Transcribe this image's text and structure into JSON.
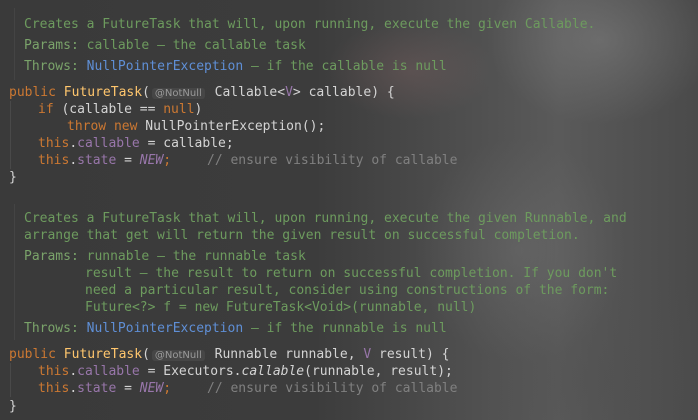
{
  "doc1": {
    "summary": "Creates a FutureTask that will, upon running, execute the given Callable.",
    "params_label": "Params:",
    "params_text": "callable – the callable task",
    "throws_label": "Throws:",
    "throws_link": "NullPointerException",
    "throws_text": " – if the callable is null"
  },
  "code1": {
    "sig_public": "public ",
    "sig_name": "FutureTask",
    "sig_paren": "(",
    "annotation": "@NotNull",
    "sig_type": " Callable<",
    "sig_typeparam": "V",
    "sig_rest": "> callable) {",
    "if_kw": "if ",
    "if_cond": "(callable == ",
    "null_kw": "null",
    "if_close": ")",
    "throw_kw": "throw new ",
    "throw_rest": "NullPointerException();",
    "this_kw": "this",
    "dot": ".",
    "field_callable": "callable",
    "assign_callable": " = callable;",
    "field_state": "state",
    "assign_eq": " = ",
    "const_new": "NEW",
    "semi": ";",
    "comment": "// ensure visibility of callable",
    "close_brace": "}"
  },
  "doc2": {
    "summary_line1": "Creates a FutureTask that will, upon running, execute the given Runnable, and",
    "summary_line2": "arrange that get will return the given result on successful completion.",
    "params_label": "Params:",
    "param1": "runnable – the runnable task",
    "param2_line1": "result – the result to return on successful completion. If you don't",
    "param2_line2": "need a particular result, consider using constructions of the form:",
    "param2_line3": "Future<?> f = new FutureTask<Void>(runnable, null)",
    "throws_label": "Throws:",
    "throws_link": "NullPointerException",
    "throws_text": " – if the runnable is null"
  },
  "code2": {
    "sig_public": "public ",
    "sig_name": "FutureTask",
    "sig_paren": "(",
    "annotation": "@NotNull",
    "sig_type": " Runnable runnable, ",
    "sig_typeparam": "V",
    "sig_rest": " result) {",
    "this_kw": "this",
    "dot": ".",
    "field_callable": "callable",
    "assign_exec": " = Executors.",
    "call_callable": "callable",
    "call_args": "(runnable, result);",
    "field_state": "state",
    "assign_eq": " = ",
    "const_new": "NEW",
    "semi": ";",
    "comment": "// ensure visibility of callable",
    "close_brace": "}"
  }
}
